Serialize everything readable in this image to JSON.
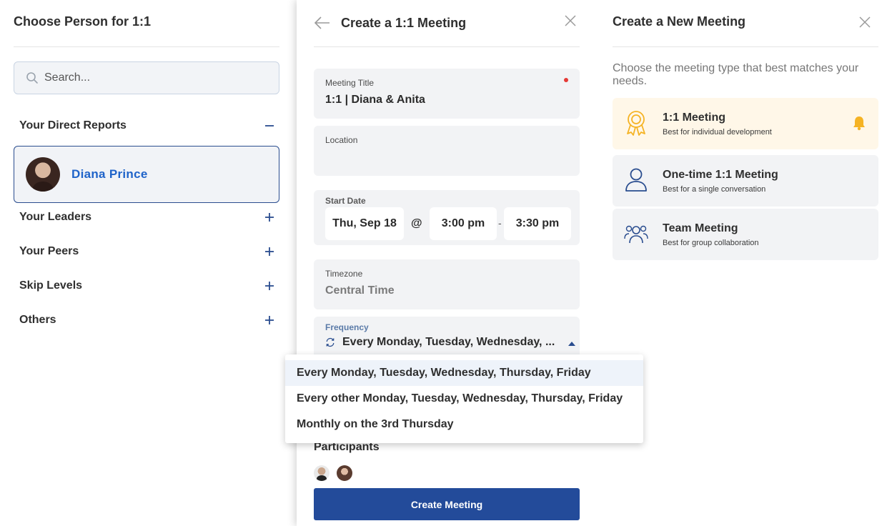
{
  "person_panel": {
    "title": "Choose Person for 1:1",
    "search_placeholder": "Search...",
    "sections": {
      "direct_reports": "Your Direct Reports",
      "leaders": "Your Leaders",
      "peers": "Your Peers",
      "skip_levels": "Skip Levels",
      "others": "Others"
    },
    "selected_person": "Diana Prince"
  },
  "meeting_form": {
    "title": "Create a 1:1 Meeting",
    "meeting_title_label": "Meeting Title",
    "meeting_title_value": "1:1 | Diana & Anita",
    "location_label": "Location",
    "location_value": "",
    "start_date_label": "Start Date",
    "start_date_value": "Thu, Sep 18",
    "at_symbol": "@",
    "start_time": "3:00 pm",
    "separator": "-",
    "end_time": "3:30 pm",
    "timezone_label": "Timezone",
    "timezone_value": "Central Time",
    "frequency_label": "Frequency",
    "frequency_value": "Every Monday, Tuesday, Wednesday, ...",
    "participants_label": "Participants",
    "create_button": "Create Meeting"
  },
  "frequency_options": [
    "Every Monday, Tuesday, Wednesday, Thursday, Friday",
    "Every other Monday, Tuesday, Wednesday, Thursday, Friday",
    "Monthly on the 3rd Thursday"
  ],
  "meeting_types_panel": {
    "title": "Create a New Meeting",
    "description": "Choose the meeting type that best matches your needs.",
    "types": [
      {
        "title": "1:1 Meeting",
        "subtitle": "Best for individual development",
        "icon": "award-ribbon-icon"
      },
      {
        "title": "One-time 1:1 Meeting",
        "subtitle": "Best for a single conversation",
        "icon": "person-icon"
      },
      {
        "title": "Team Meeting",
        "subtitle": "Best for group collaboration",
        "icon": "group-icon"
      }
    ]
  },
  "colors": {
    "primary": "#234b9a",
    "link_blue": "#1f63c9",
    "accent_gold": "#f5b324",
    "required_red": "#e53935",
    "field_bg": "#f2f3f5"
  }
}
